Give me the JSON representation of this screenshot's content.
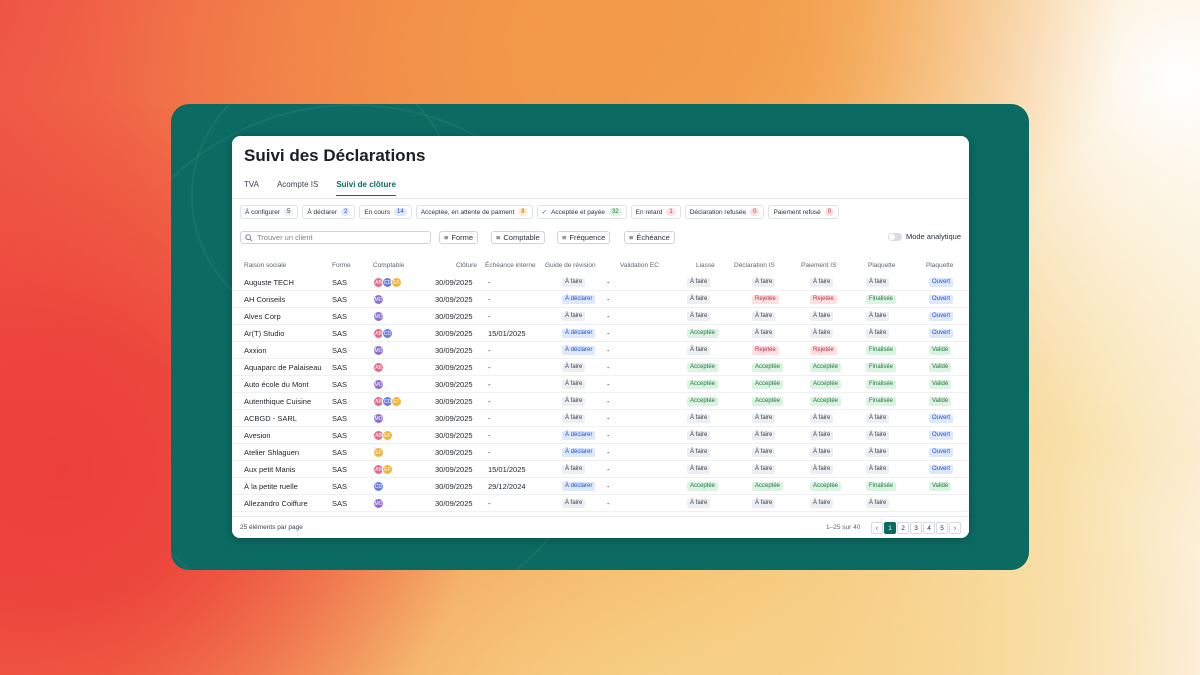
{
  "page": {
    "title": "Suivi des Déclarations",
    "tabs": [
      {
        "label": "TVA"
      },
      {
        "label": "Acompte IS"
      },
      {
        "label": "Suivi de clôture",
        "active": true
      }
    ]
  },
  "filters": [
    {
      "label": "À configurer",
      "count": "5"
    },
    {
      "label": "À déclarer",
      "count": "2"
    },
    {
      "label": "En cours",
      "count": "14"
    },
    {
      "label": "Acceptée, en attente de paiment",
      "count": "8"
    },
    {
      "label": "Acceptée et payée",
      "count": "32",
      "icon": "check-icon"
    },
    {
      "label": "En retard",
      "count": "1"
    },
    {
      "label": "Déclaration refusée",
      "count": "0"
    },
    {
      "label": "Paiement refusé",
      "count": "0"
    }
  ],
  "toolbar": {
    "search_placeholder": "Trouver un client",
    "filter_buttons": [
      "Forme",
      "Comptable",
      "Fréquence",
      "Échéance"
    ],
    "toggle_label": "Mode analytique"
  },
  "table": {
    "columns": [
      "Raison sociale",
      "Forme",
      "Comptable",
      "Clôture",
      "Échéance interne",
      "Guide de révision",
      "Validation EC",
      "Liasse",
      "Déclaration IS",
      "Paiement IS",
      "Plaquette",
      "Plaquette"
    ],
    "rows": [
      {
        "name": "Auguste TECH",
        "forme": "SAS",
        "avatars": [
          "AB",
          "CD",
          "EF"
        ],
        "cloture": "30/09/2025",
        "echeance": "-",
        "guide": "À faire",
        "validation": "-",
        "liasse": "À faire",
        "decl": "À faire",
        "paie": "À faire",
        "plaq": "À faire",
        "plaq2": "Ouvert"
      },
      {
        "name": "AH Conseils",
        "forme": "SAS",
        "avatars": [
          "MO"
        ],
        "cloture": "30/09/2025",
        "echeance": "-",
        "guide": "À déclarer",
        "validation": "-",
        "liasse": "À faire",
        "decl": "Rejetée",
        "paie": "Rejetée",
        "plaq": "Finalisée",
        "plaq2": "Ouvert"
      },
      {
        "name": "Alves Corp",
        "forme": "SAS",
        "avatars": [
          "MO"
        ],
        "cloture": "30/09/2025",
        "echeance": "-",
        "guide": "À faire",
        "validation": "-",
        "liasse": "À faire",
        "decl": "À faire",
        "paie": "À faire",
        "plaq": "À faire",
        "plaq2": "Ouvert"
      },
      {
        "name": "Ar(T) Studio",
        "forme": "SAS",
        "avatars": [
          "AB",
          "CD"
        ],
        "cloture": "30/09/2025",
        "echeance": "15/01/2025",
        "guide": "À déclarer",
        "validation": "-",
        "liasse": "Acceptée",
        "decl": "À faire",
        "paie": "À faire",
        "plaq": "À faire",
        "plaq2": "Ouvert"
      },
      {
        "name": "Axxion",
        "forme": "SAS",
        "avatars": [
          "MO"
        ],
        "cloture": "30/09/2025",
        "echeance": "-",
        "guide": "À déclarer",
        "validation": "-",
        "liasse": "À faire",
        "decl": "Rejetée",
        "paie": "Rejetée",
        "plaq": "Finalisée",
        "plaq2": "Validé"
      },
      {
        "name": "Aquaparc de Palaiseau",
        "forme": "SAS",
        "avatars": [
          "AB"
        ],
        "cloture": "30/09/2025",
        "echeance": "-",
        "guide": "À faire",
        "validation": "-",
        "liasse": "Acceptée",
        "decl": "Acceptée",
        "paie": "Acceptée",
        "plaq": "Finalisée",
        "plaq2": "Validé"
      },
      {
        "name": "Auto école du Mont",
        "forme": "SAS",
        "avatars": [
          "MO"
        ],
        "cloture": "30/09/2025",
        "echeance": "-",
        "guide": "À faire",
        "validation": "-",
        "liasse": "Acceptée",
        "decl": "Acceptée",
        "paie": "Acceptée",
        "plaq": "Finalisée",
        "plaq2": "Validé"
      },
      {
        "name": "Autenthique Cuisine",
        "forme": "SAS",
        "avatars": [
          "AB",
          "CD",
          "EF"
        ],
        "cloture": "30/09/2025",
        "echeance": "-",
        "guide": "À faire",
        "validation": "-",
        "liasse": "Acceptée",
        "decl": "Acceptée",
        "paie": "Acceptée",
        "plaq": "Finalisée",
        "plaq2": "Validé"
      },
      {
        "name": "ACBGD - SARL",
        "forme": "SAS",
        "avatars": [
          "MO"
        ],
        "cloture": "30/09/2025",
        "echeance": "-",
        "guide": "À faire",
        "validation": "-",
        "liasse": "À faire",
        "decl": "À faire",
        "paie": "À faire",
        "plaq": "À faire",
        "plaq2": "Ouvert"
      },
      {
        "name": "Avesion",
        "forme": "SAS",
        "avatars": [
          "AB",
          "EF"
        ],
        "cloture": "30/09/2025",
        "echeance": "-",
        "guide": "À déclarer",
        "validation": "-",
        "liasse": "À faire",
        "decl": "À faire",
        "paie": "À faire",
        "plaq": "À faire",
        "plaq2": "Ouvert"
      },
      {
        "name": "Atelier Shlaguen",
        "forme": "SAS",
        "avatars": [
          "EF"
        ],
        "cloture": "30/09/2025",
        "echeance": "-",
        "guide": "À déclarer",
        "validation": "-",
        "liasse": "À faire",
        "decl": "À faire",
        "paie": "À faire",
        "plaq": "À faire",
        "plaq2": "Ouvert"
      },
      {
        "name": "Aux petit Manis",
        "forme": "SAS",
        "avatars": [
          "AB",
          "EF"
        ],
        "cloture": "30/09/2025",
        "echeance": "15/01/2025",
        "guide": "À faire",
        "validation": "-",
        "liasse": "À faire",
        "decl": "À faire",
        "paie": "À faire",
        "plaq": "À faire",
        "plaq2": "Ouvert"
      },
      {
        "name": "À la petite ruelle",
        "forme": "SAS",
        "avatars": [
          "CD"
        ],
        "cloture": "30/09/2025",
        "echeance": "29/12/2024",
        "guide": "À déclarer",
        "validation": "-",
        "liasse": "Acceptée",
        "decl": "Acceptée",
        "paie": "Acceptée",
        "plaq": "Finalisée",
        "plaq2": "Validé"
      },
      {
        "name": "Allezandro Coiffure",
        "forme": "SAS",
        "avatars": [
          "MO"
        ],
        "cloture": "30/09/2025",
        "echeance": "-",
        "guide": "À faire",
        "validation": "-",
        "liasse": "À faire",
        "decl": "À faire",
        "paie": "À faire",
        "plaq": "À faire",
        "plaq2": ""
      }
    ]
  },
  "footer": {
    "per_page": "25 éléments par page",
    "range": "1–25 sur 40",
    "pages": [
      "1",
      "2",
      "3",
      "4",
      "5"
    ],
    "prev": "‹",
    "next": "›"
  },
  "colors": {
    "frame": "#0b6b62",
    "accent": "#0b6b62",
    "avatar_AB": "#e36c8a",
    "avatar_CD": "#6b7de0",
    "avatar_EF": "#f0b43a",
    "avatar_MO": "#8c6fd1"
  }
}
